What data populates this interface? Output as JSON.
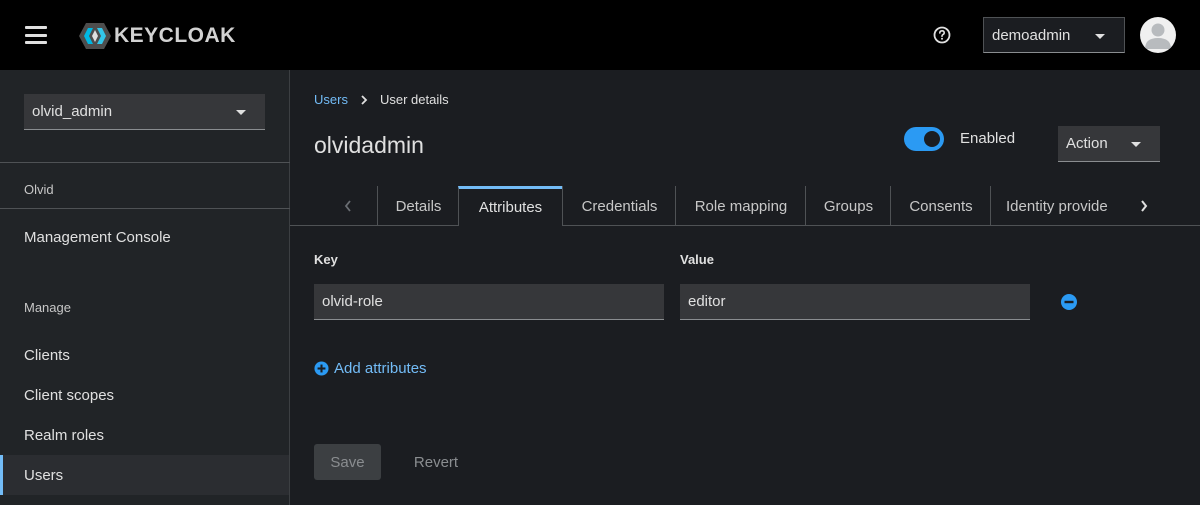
{
  "masthead": {
    "brand": "KEYCLOAK",
    "user": "demoadmin"
  },
  "sidebar": {
    "realm": "olvid_admin",
    "realm_section": "Olvid",
    "console_item": "Management Console",
    "manage_section": "Manage",
    "items": [
      {
        "label": "Clients",
        "active": false
      },
      {
        "label": "Client scopes",
        "active": false
      },
      {
        "label": "Realm roles",
        "active": false
      },
      {
        "label": "Users",
        "active": true
      }
    ]
  },
  "breadcrumb": {
    "parent": "Users",
    "current": "User details"
  },
  "page": {
    "title": "olvidadmin",
    "enabled_label": "Enabled",
    "enabled": true,
    "action_label": "Action"
  },
  "tabs": [
    {
      "label": "Details",
      "active": false
    },
    {
      "label": "Attributes",
      "active": true
    },
    {
      "label": "Credentials",
      "active": false
    },
    {
      "label": "Role mapping",
      "active": false
    },
    {
      "label": "Groups",
      "active": false
    },
    {
      "label": "Consents",
      "active": false
    },
    {
      "label": "Identity provide",
      "active": false
    }
  ],
  "attributes": {
    "key_header": "Key",
    "value_header": "Value",
    "rows": [
      {
        "key": "olvid-role",
        "value": "editor"
      }
    ],
    "add_label": "Add attributes"
  },
  "footer": {
    "save_label": "Save",
    "revert_label": "Revert"
  },
  "colors": {
    "accent": "#73bcf7",
    "toggle": "#2b9af3",
    "masthead": "#000000",
    "background": "#1b1d21"
  }
}
